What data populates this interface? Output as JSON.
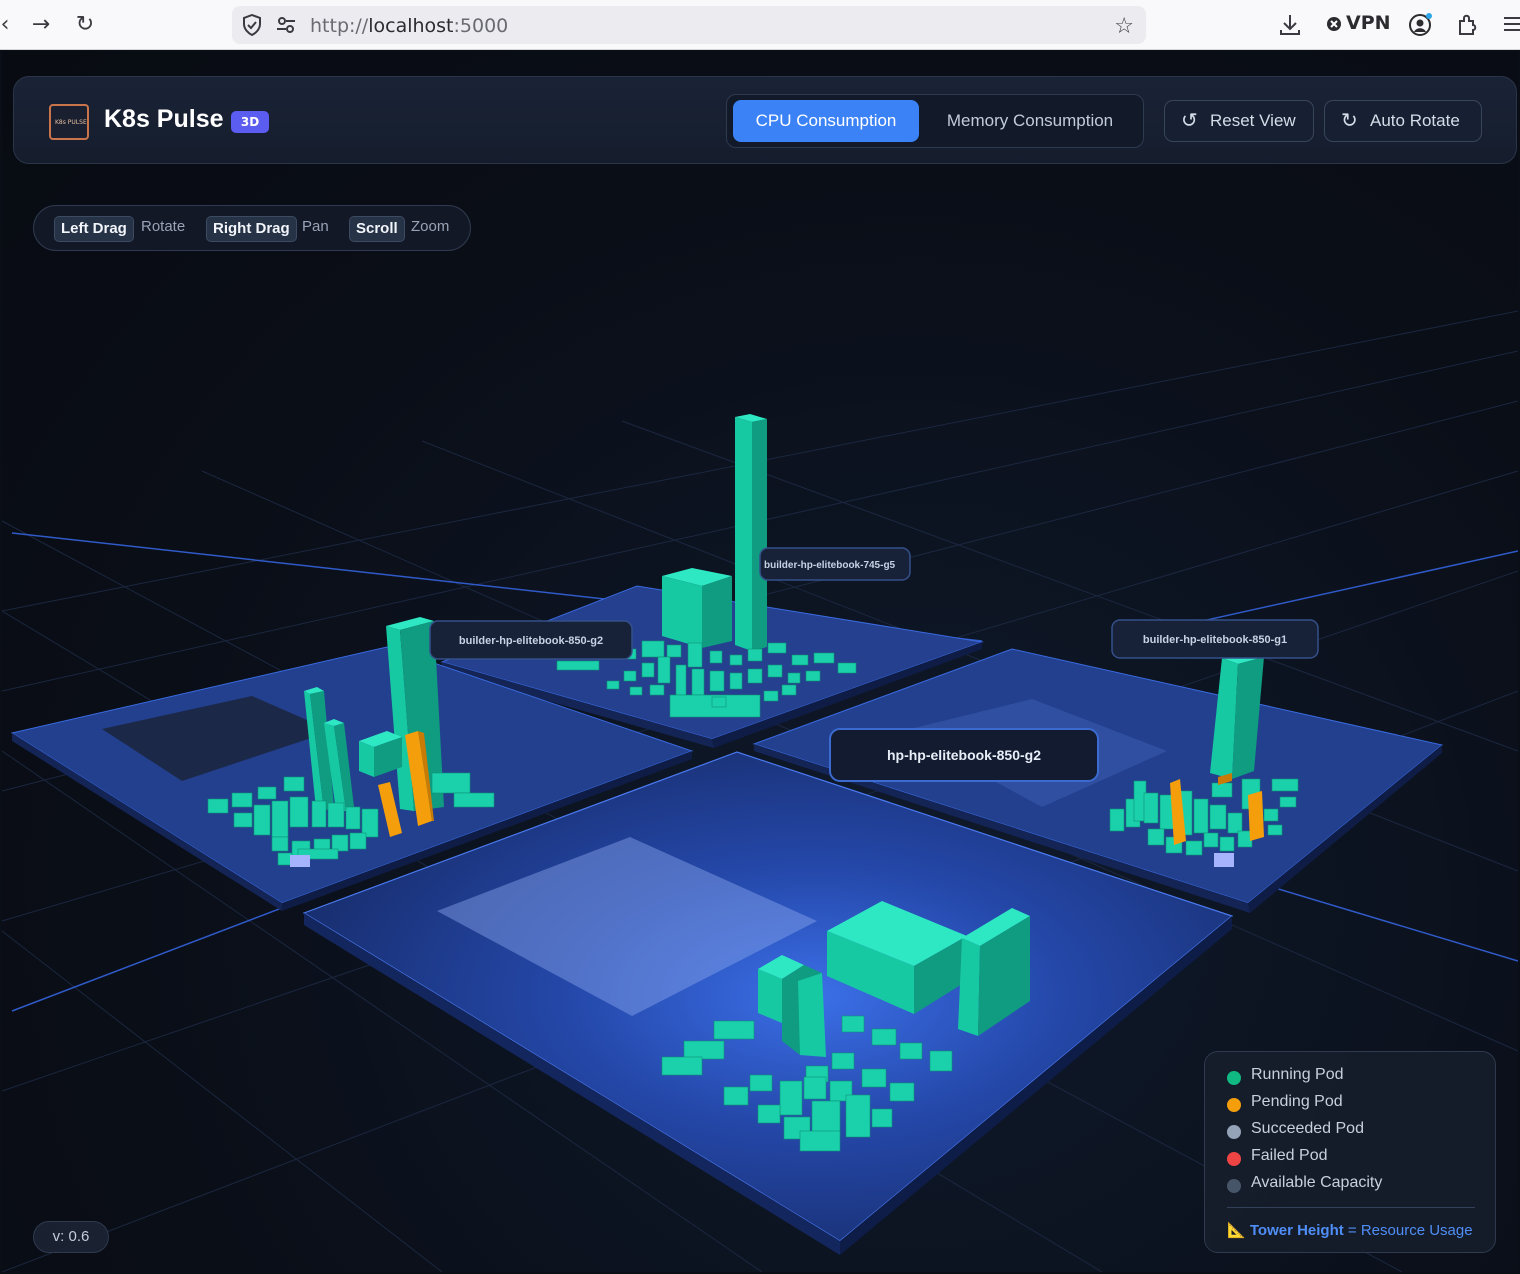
{
  "browser": {
    "url_scheme": "http://",
    "url_host": "localhost",
    "url_port": ":5000",
    "vpn_label": "VPN"
  },
  "header": {
    "brand": "K8s Pulse",
    "badge": "3D",
    "logo_text": "K8s PULSE",
    "tabs": [
      {
        "label": "CPU Consumption",
        "active": true
      },
      {
        "label": "Memory Consumption",
        "active": false
      }
    ],
    "reset_label": "Reset View",
    "rotate_label": "Auto Rotate"
  },
  "hints": [
    {
      "key": "Left Drag",
      "action": "Rotate"
    },
    {
      "key": "Right Drag",
      "action": "Pan"
    },
    {
      "key": "Scroll",
      "action": "Zoom"
    }
  ],
  "nodes": [
    {
      "name": "builder-hp-elitebook-745-g5"
    },
    {
      "name": "builder-hp-elitebook-850-g2"
    },
    {
      "name": "builder-hp-elitebook-850-g1"
    },
    {
      "name": "hp-hp-elitebook-850-g2"
    }
  ],
  "legend": {
    "items": [
      {
        "label": "Running Pod",
        "color": "#10b981"
      },
      {
        "label": "Pending Pod",
        "color": "#f59e0b"
      },
      {
        "label": "Succeeded Pod",
        "color": "#94a3b8"
      },
      {
        "label": "Failed Pod",
        "color": "#ef4444"
      },
      {
        "label": "Available Capacity",
        "color": "#475569"
      }
    ],
    "footer_bold": "Tower Height",
    "footer_rest": " = Resource Usage",
    "footer_icon": "ruler-icon"
  },
  "version": "v: 0.6",
  "colors": {
    "running": "#10b981",
    "running_top": "#2ee8c4",
    "pending": "#f59e0b",
    "succeeded": "#a5b4fc",
    "platform": "#1e3a8a",
    "accent": "#3b82f6"
  }
}
